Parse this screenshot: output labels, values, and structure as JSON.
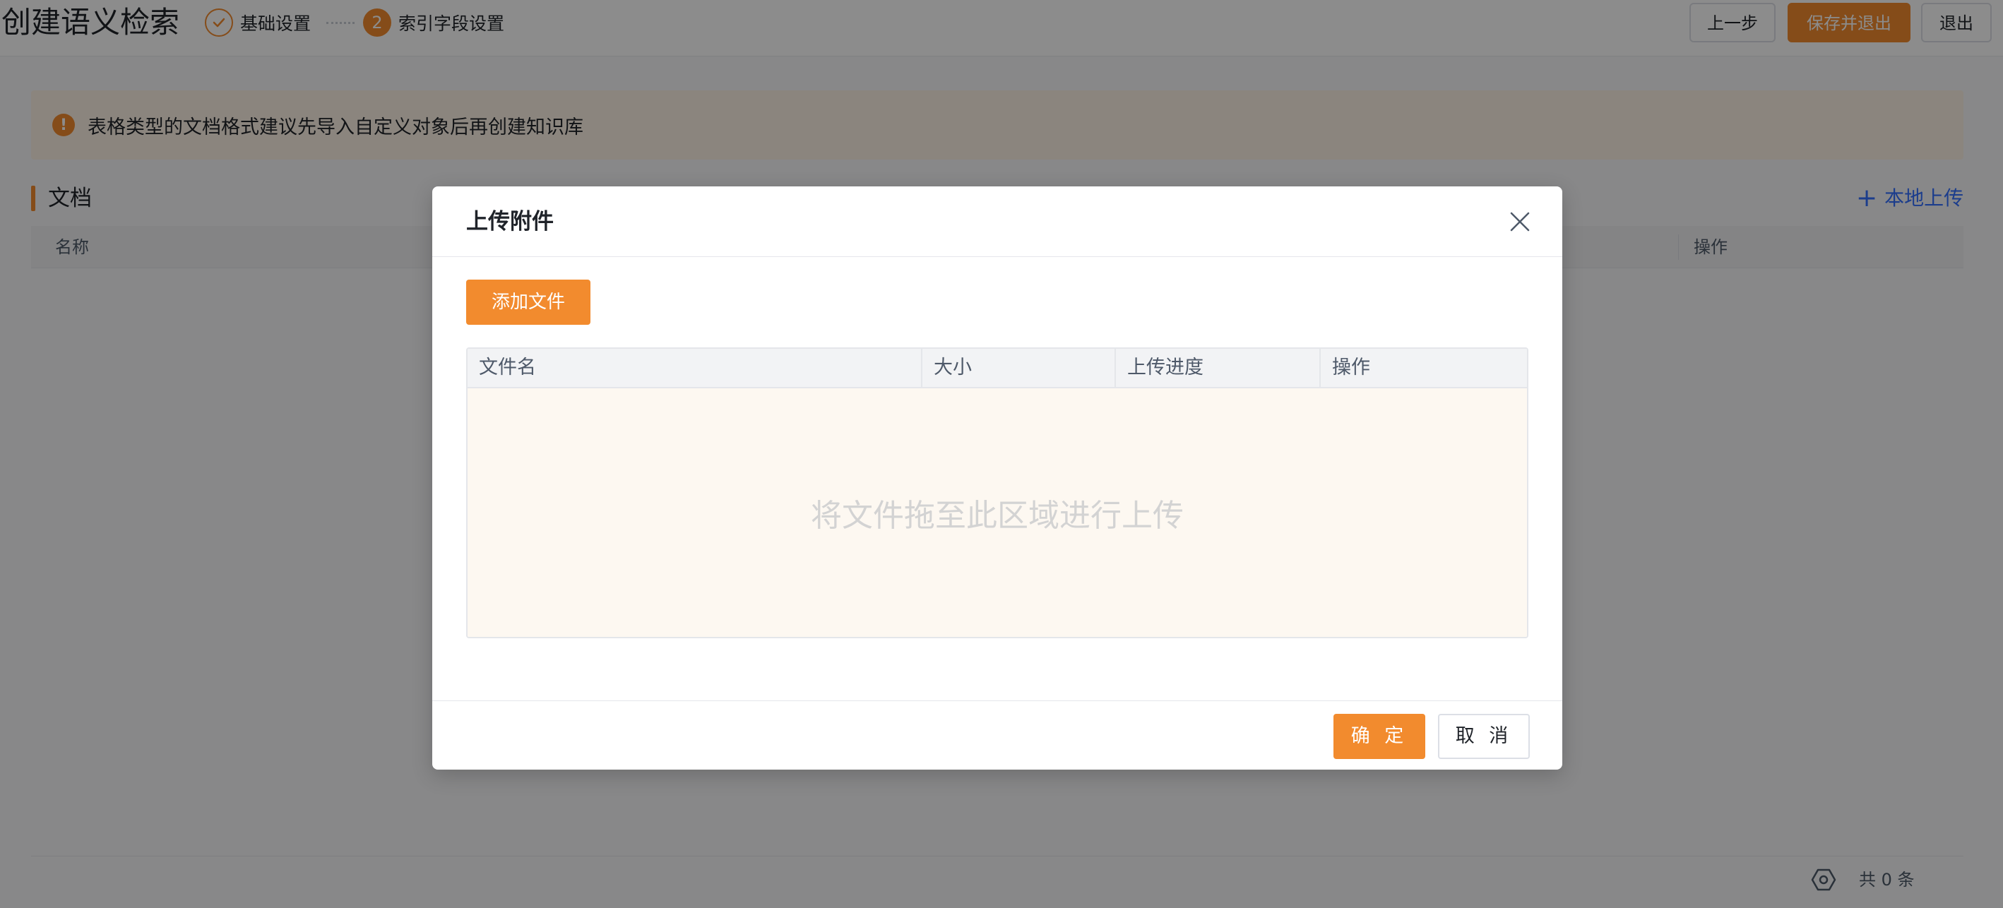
{
  "header": {
    "title": "创建语义检索",
    "steps": [
      {
        "label": "基础设置",
        "status": "done",
        "icon": "check-circle-icon"
      },
      {
        "number": "2",
        "label": "索引字段设置",
        "status": "current"
      }
    ],
    "buttons": {
      "prev_label": "上一步",
      "save_exit_label": "保存并退出",
      "exit_label": "退出"
    }
  },
  "alert": {
    "icon": "warning-icon",
    "icon_glyph": "!",
    "text": "表格类型的文档格式建议先导入自定义对象后再创建知识库"
  },
  "documents": {
    "section_title": "文档",
    "upload_label": "本地上传",
    "upload_icon": "plus-icon",
    "columns": [
      "名称",
      "操作"
    ],
    "total_text": "共 0 条"
  },
  "modal": {
    "title": "上传附件",
    "add_file_label": "添加文件",
    "columns": [
      "文件名",
      "大小",
      "上传进度",
      "操作"
    ],
    "dropzone_text": "将文件拖至此区域进行上传",
    "ok_label": "确 定",
    "cancel_label": "取 消"
  },
  "colors": {
    "accent": "#f28b2e",
    "link": "#3370ff",
    "overlay": "rgba(0,0,0,0.45)",
    "dropzone_bg": "#fdf8f1"
  }
}
